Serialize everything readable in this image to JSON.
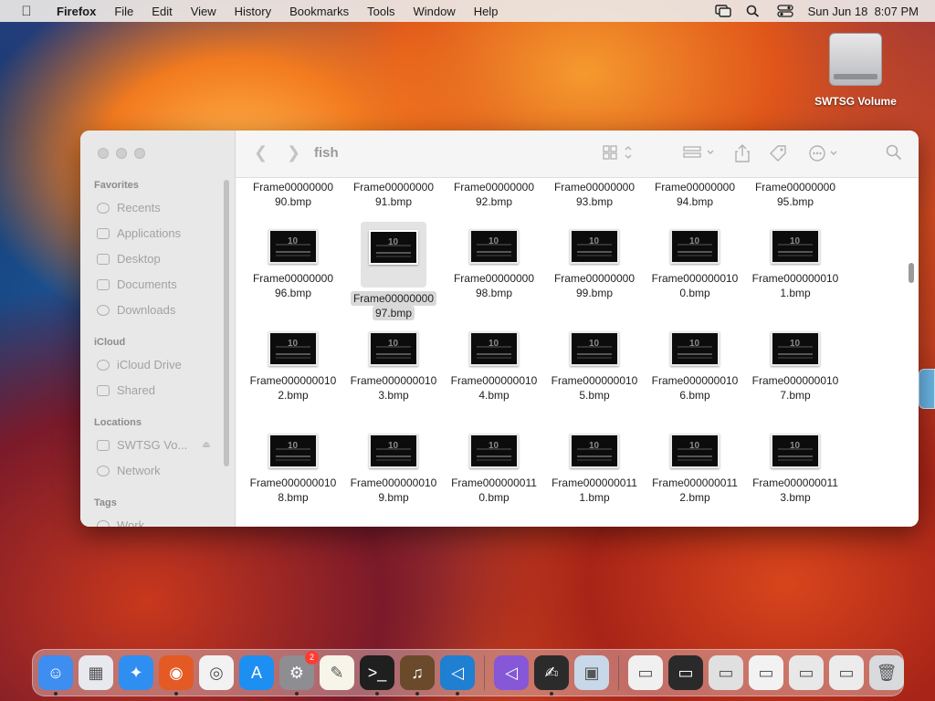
{
  "menubar": {
    "app_name": "Firefox",
    "items": [
      "File",
      "Edit",
      "View",
      "History",
      "Bookmarks",
      "Tools",
      "Window",
      "Help"
    ],
    "clock": "Sun Jun 18  8:07 PM"
  },
  "desktop": {
    "volume_label": "SWTSG Volume"
  },
  "finder": {
    "folder_title": "fish",
    "sidebar": {
      "favorites_header": "Favorites",
      "favorites": [
        "Recents",
        "Applications",
        "Desktop",
        "Documents",
        "Downloads"
      ],
      "icloud_header": "iCloud",
      "icloud": [
        "iCloud Drive",
        "Shared"
      ],
      "locations_header": "Locations",
      "locations": [
        "SWTSG Vo...",
        "Network"
      ],
      "tags_header": "Tags",
      "tags": [
        "Work"
      ]
    },
    "files": [
      {
        "line1": "Frame00000000",
        "line2": "90.bmp"
      },
      {
        "line1": "Frame00000000",
        "line2": "91.bmp"
      },
      {
        "line1": "Frame00000000",
        "line2": "92.bmp"
      },
      {
        "line1": "Frame00000000",
        "line2": "93.bmp"
      },
      {
        "line1": "Frame00000000",
        "line2": "94.bmp"
      },
      {
        "line1": "Frame00000000",
        "line2": "95.bmp"
      },
      {
        "line1": "Frame00000000",
        "line2": "96.bmp"
      },
      {
        "line1": "Frame00000000",
        "line2": "97.bmp",
        "selected": true
      },
      {
        "line1": "Frame00000000",
        "line2": "98.bmp"
      },
      {
        "line1": "Frame00000000",
        "line2": "99.bmp"
      },
      {
        "line1": "Frame000000010",
        "line2": "0.bmp"
      },
      {
        "line1": "Frame000000010",
        "line2": "1.bmp"
      },
      {
        "line1": "Frame000000010",
        "line2": "2.bmp"
      },
      {
        "line1": "Frame000000010",
        "line2": "3.bmp"
      },
      {
        "line1": "Frame000000010",
        "line2": "4.bmp"
      },
      {
        "line1": "Frame000000010",
        "line2": "5.bmp"
      },
      {
        "line1": "Frame000000010",
        "line2": "6.bmp"
      },
      {
        "line1": "Frame000000010",
        "line2": "7.bmp"
      },
      {
        "line1": "Frame000000010",
        "line2": "8.bmp"
      },
      {
        "line1": "Frame000000010",
        "line2": "9.bmp"
      },
      {
        "line1": "Frame000000011",
        "line2": "0.bmp"
      },
      {
        "line1": "Frame000000011",
        "line2": "1.bmp"
      },
      {
        "line1": "Frame000000011",
        "line2": "2.bmp"
      },
      {
        "line1": "Frame000000011",
        "line2": "3.bmp"
      }
    ]
  },
  "dock": {
    "apps": [
      {
        "name": "finder",
        "icon": "finder-icon",
        "color": "#3d8ef0",
        "glyph": "☺",
        "running": true
      },
      {
        "name": "launchpad",
        "icon": "launchpad-icon",
        "color": "#e8e8ef",
        "glyph": "▦",
        "running": false
      },
      {
        "name": "safari",
        "icon": "safari-icon",
        "color": "#2f8ff0",
        "glyph": "✦",
        "running": false
      },
      {
        "name": "firefox",
        "icon": "firefox-icon",
        "color": "#e45a24",
        "glyph": "◉",
        "running": true
      },
      {
        "name": "chrome",
        "icon": "chrome-icon",
        "color": "#f2f2f2",
        "glyph": "◎",
        "running": false
      },
      {
        "name": "app-store",
        "icon": "app-store-icon",
        "color": "#1e8ff2",
        "glyph": "A",
        "running": false
      },
      {
        "name": "system-settings",
        "icon": "gear-icon",
        "color": "#8d8d92",
        "glyph": "⚙",
        "running": true,
        "badge": "2"
      },
      {
        "name": "textedit",
        "icon": "textedit-icon",
        "color": "#f7f4ea",
        "glyph": "✎",
        "running": false
      },
      {
        "name": "terminal",
        "icon": "terminal-icon",
        "color": "#1f1f1f",
        "glyph": ">_",
        "running": true
      },
      {
        "name": "guitar-app",
        "icon": "guitar-icon",
        "color": "#6a4a2a",
        "glyph": "♫",
        "running": true
      },
      {
        "name": "vscode",
        "icon": "vscode-icon",
        "color": "#1f7fd1",
        "glyph": "◁",
        "running": true
      },
      {
        "name": "visual-studio",
        "icon": "visual-studio-icon",
        "color": "#8657d6",
        "glyph": "◁",
        "running": false
      },
      {
        "name": "doc-viewer",
        "icon": "document-icon",
        "color": "#2b2b2b",
        "glyph": "✍",
        "running": true
      },
      {
        "name": "preview",
        "icon": "preview-icon",
        "color": "#c8d8e8",
        "glyph": "▣",
        "running": false
      },
      {
        "name": "window-1",
        "icon": "window-thumb-icon",
        "color": "#f0f0f0",
        "glyph": "▭",
        "running": false
      },
      {
        "name": "window-2",
        "icon": "window-thumb-icon",
        "color": "#2a2a2a",
        "glyph": "▭",
        "running": false
      },
      {
        "name": "window-3",
        "icon": "window-thumb-icon",
        "color": "#e0e0e0",
        "glyph": "▭",
        "running": false
      },
      {
        "name": "window-4",
        "icon": "window-thumb-icon",
        "color": "#f2f2f2",
        "glyph": "▭",
        "running": false
      },
      {
        "name": "window-5",
        "icon": "window-thumb-icon",
        "color": "#e8e8e8",
        "glyph": "▭",
        "running": false
      },
      {
        "name": "window-6",
        "icon": "window-thumb-icon",
        "color": "#ececec",
        "glyph": "▭",
        "running": false
      },
      {
        "name": "trash",
        "icon": "trash-icon",
        "color": "#d8dadd",
        "glyph": "🗑",
        "running": false
      }
    ]
  }
}
